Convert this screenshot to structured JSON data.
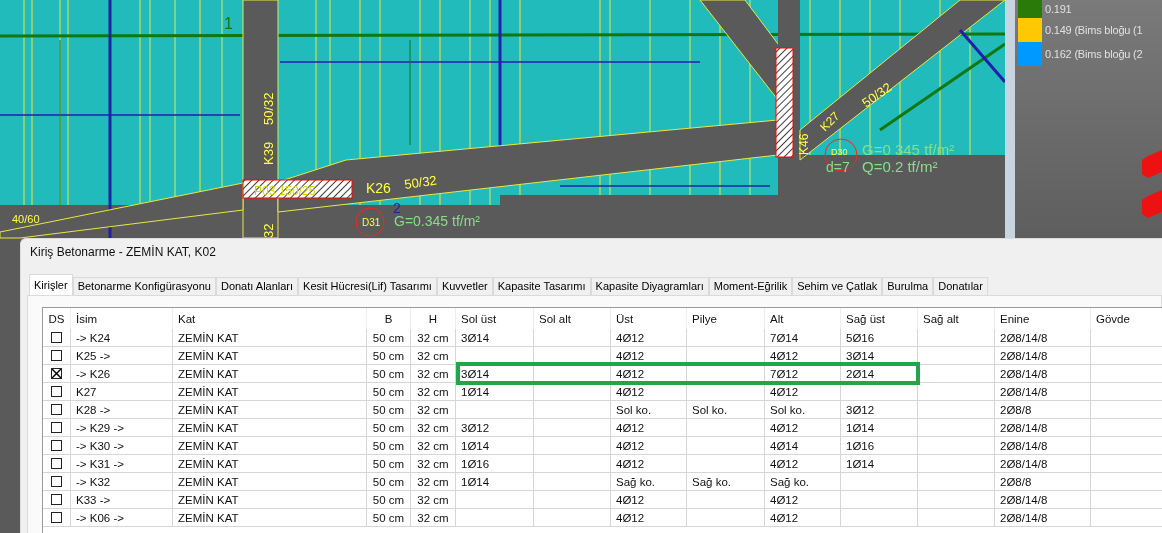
{
  "cad": {
    "labels": [
      "1",
      "50/32",
      "50/32",
      "K27",
      "K39",
      "K46",
      "D30",
      "G=0 345 tf/m²",
      "d=7",
      "Q=0.2 tf/m²",
      "50/32",
      "P03 150/25",
      "K26",
      "2",
      "40/60",
      "D31",
      "G=0.345 tf/m²",
      "32"
    ]
  },
  "legend": [
    {
      "color": "#2a7a0a",
      "label": "0.191"
    },
    {
      "color": "#ffc800",
      "label": "0.149 (Bims bloğu (1"
    },
    {
      "color": "#0099ff",
      "label": "0.162 (Bims bloğu (2"
    }
  ],
  "dialog": {
    "title": "Kiriş Betonarme - ZEMİN KAT, K02",
    "tabs": [
      {
        "label": "Kirişler",
        "selected": true
      },
      {
        "label": "Betonarme Konfigürasyonu",
        "selected": false
      },
      {
        "label": "Donatı Alanları",
        "selected": false
      },
      {
        "label": "Kesit Hücresi(Lif) Tasarımı",
        "selected": false
      },
      {
        "label": "Kuvvetler",
        "selected": false
      },
      {
        "label": "Kapasite Tasarımı",
        "selected": false
      },
      {
        "label": "Kapasite Diyagramları",
        "selected": false
      },
      {
        "label": "Moment-Eğrilik",
        "selected": false
      },
      {
        "label": "Sehim ve Çatlak",
        "selected": false
      },
      {
        "label": "Burulma",
        "selected": false
      },
      {
        "label": "Donatılar",
        "selected": false
      }
    ],
    "table": {
      "columns": [
        "DS",
        "İsim",
        "Kat",
        "B",
        "H",
        "Sol üst",
        "Sol alt",
        "Üst",
        "Pilye",
        "Alt",
        "Sağ üst",
        "Sağ alt",
        "Enine",
        "Gövde"
      ],
      "rows": [
        {
          "checked": false,
          "highlighted": false,
          "cells": [
            "",
            "-> K24",
            "ZEMİN KAT",
            "50 cm",
            "32 cm",
            "3Ø14",
            null,
            "4Ø12",
            null,
            "7Ø14",
            "5Ø16",
            null,
            "2Ø8/14/8",
            null
          ]
        },
        {
          "checked": false,
          "highlighted": false,
          "cells": [
            "",
            "K25 ->",
            "ZEMİN KAT",
            "50 cm",
            "32 cm",
            null,
            null,
            "4Ø12",
            null,
            "4Ø12",
            "3Ø14",
            null,
            "2Ø8/14/8",
            null
          ]
        },
        {
          "checked": true,
          "highlighted": true,
          "cells": [
            "",
            "-> K26",
            "ZEMİN KAT",
            "50 cm",
            "32 cm",
            "3Ø14",
            null,
            "4Ø12",
            null,
            "7Ø12",
            "2Ø14",
            null,
            "2Ø8/14/8",
            null
          ]
        },
        {
          "checked": false,
          "highlighted": false,
          "cells": [
            "",
            "K27",
            "ZEMİN KAT",
            "50 cm",
            "32 cm",
            "1Ø14",
            null,
            "4Ø12",
            null,
            "4Ø12",
            null,
            null,
            "2Ø8/14/8",
            null
          ]
        },
        {
          "checked": false,
          "highlighted": false,
          "cells": [
            "",
            "K28 ->",
            "ZEMİN KAT",
            "50 cm",
            "32 cm",
            null,
            null,
            "Sol ko.",
            "Sol ko.",
            "Sol ko.",
            "3Ø12",
            null,
            "2Ø8/8",
            null
          ]
        },
        {
          "checked": false,
          "highlighted": false,
          "cells": [
            "",
            "-> K29 ->",
            "ZEMİN KAT",
            "50 cm",
            "32 cm",
            "3Ø12",
            null,
            "4Ø12",
            null,
            "4Ø12",
            "1Ø14",
            null,
            "2Ø8/14/8",
            null
          ]
        },
        {
          "checked": false,
          "highlighted": false,
          "cells": [
            "",
            "-> K30 ->",
            "ZEMİN KAT",
            "50 cm",
            "32 cm",
            "1Ø14",
            null,
            "4Ø12",
            null,
            "4Ø14",
            "1Ø16",
            null,
            "2Ø8/14/8",
            null
          ]
        },
        {
          "checked": false,
          "highlighted": false,
          "cells": [
            "",
            "-> K31 ->",
            "ZEMİN KAT",
            "50 cm",
            "32 cm",
            "1Ø16",
            null,
            "4Ø12",
            null,
            "4Ø12",
            "1Ø14",
            null,
            "2Ø8/14/8",
            null
          ]
        },
        {
          "checked": false,
          "highlighted": false,
          "cells": [
            "",
            "-> K32",
            "ZEMİN KAT",
            "50 cm",
            "32 cm",
            "1Ø14",
            null,
            "Sağ ko.",
            "Sağ ko.",
            "Sağ ko.",
            null,
            null,
            "2Ø8/8",
            null
          ]
        },
        {
          "checked": false,
          "highlighted": false,
          "cells": [
            "",
            "K33 ->",
            "ZEMİN KAT",
            "50 cm",
            "32 cm",
            null,
            null,
            "4Ø12",
            null,
            "4Ø12",
            null,
            null,
            "2Ø8/14/8",
            null
          ]
        },
        {
          "checked": false,
          "highlighted": false,
          "cells": [
            "",
            "-> K06 ->",
            "ZEMİN KAT",
            "50 cm",
            "32 cm",
            null,
            null,
            "4Ø12",
            null,
            "4Ø12",
            null,
            null,
            "2Ø8/14/8",
            null
          ]
        }
      ]
    }
  }
}
